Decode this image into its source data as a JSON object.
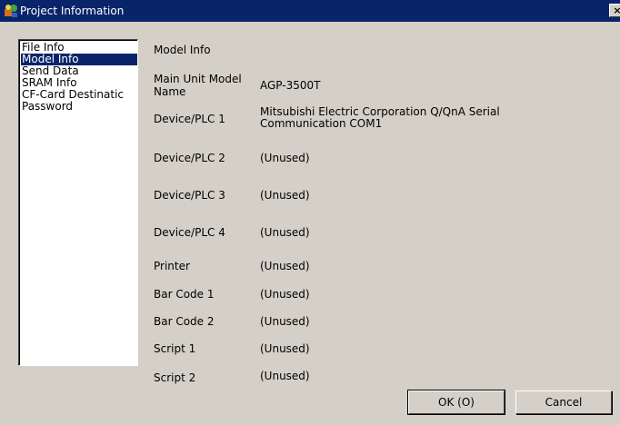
{
  "window": {
    "title": "Project Information",
    "close_glyph": "×"
  },
  "nav": {
    "items": [
      {
        "label": "File Info",
        "selected": false
      },
      {
        "label": "Model Info",
        "selected": true
      },
      {
        "label": "Send Data",
        "selected": false
      },
      {
        "label": "SRAM Info",
        "selected": false
      },
      {
        "label": "CF-Card Destinatic",
        "selected": false
      },
      {
        "label": "Password",
        "selected": false
      }
    ]
  },
  "main": {
    "section_title": "Model Info",
    "rows": [
      {
        "label_line1": "Main Unit Model",
        "label_line2": "Name",
        "value": "AGP-3500T"
      },
      {
        "label": "Device/PLC 1",
        "value_line1": "Mitsubishi Electric Corporation Q/QnA Serial",
        "value_line2": "Communication COM1"
      },
      {
        "label": "Device/PLC 2",
        "value": "(Unused)"
      },
      {
        "label": "Device/PLC 3",
        "value": "(Unused)"
      },
      {
        "label": "Device/PLC 4",
        "value": "(Unused)"
      },
      {
        "label": "Printer",
        "value": "(Unused)"
      },
      {
        "label": "Bar Code 1",
        "value": "(Unused)"
      },
      {
        "label": "Bar Code 2",
        "value": "(Unused)"
      },
      {
        "label": "Script 1",
        "value": "(Unused)"
      },
      {
        "label": "Script 2",
        "value": "(Unused)"
      }
    ]
  },
  "buttons": {
    "ok_label": "OK (O)",
    "cancel_label": "Cancel"
  },
  "colors": {
    "titlebar": "#0a246a",
    "selection": "#0a246a",
    "face": "#d4d0c8"
  }
}
